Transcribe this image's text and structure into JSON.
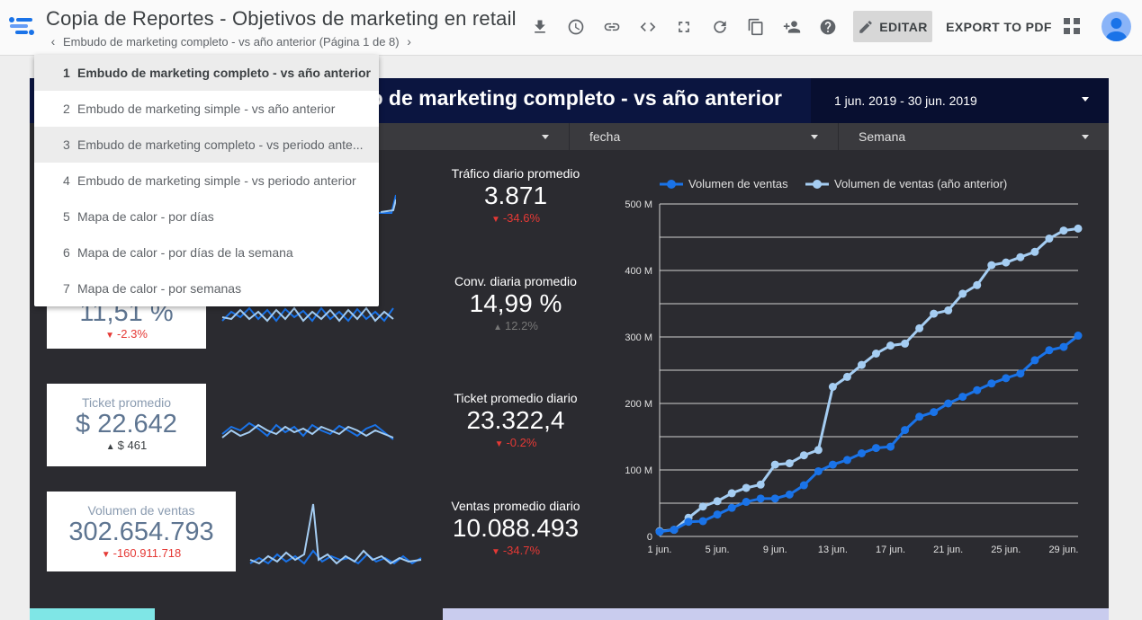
{
  "app": {
    "title": "Copia de Reportes - Objetivos de marketing en retail",
    "page_nav_label": "Embudo de marketing completo - vs año anterior (Página 1 de 8)",
    "edit_label": "EDITAR",
    "export_label": "EXPORT TO PDF",
    "toolbar_icons": [
      "download-icon",
      "history-icon",
      "link-icon",
      "embed-code-icon",
      "fullscreen-icon",
      "refresh-icon",
      "copy-icon",
      "add-person-icon",
      "help-icon",
      "pencil-icon",
      "apps-grid-icon",
      "account-avatar-icon"
    ]
  },
  "report": {
    "title": "o de marketing completo - vs año anterior",
    "date_range": "1 jun. 2019 - 30 jun. 2019",
    "filters": [
      {
        "label": ""
      },
      {
        "label": "fecha"
      },
      {
        "label": "Semana"
      }
    ]
  },
  "dropdown": {
    "items": [
      {
        "num": "1",
        "label": "Embudo de marketing completo - vs año anterior"
      },
      {
        "num": "2",
        "label": "Embudo de marketing simple - vs año anterior"
      },
      {
        "num": "3",
        "label": "Embudo de marketing completo - vs periodo ante..."
      },
      {
        "num": "4",
        "label": "Embudo de marketing simple - vs periodo anterior"
      },
      {
        "num": "5",
        "label": "Mapa de calor - por días"
      },
      {
        "num": "6",
        "label": "Mapa de calor - por días de la semana"
      },
      {
        "num": "7",
        "label": "Mapa de calor - por semanas"
      }
    ]
  },
  "kpis_left": [
    {
      "label": "",
      "value": "11,51 %",
      "delta": "-2.3%",
      "trend": "down"
    },
    {
      "label": "Ticket promedio",
      "value": "$ 22.642",
      "delta": "$ 461",
      "trend": "up"
    },
    {
      "label": "Volumen de ventas",
      "value": "302.654.793",
      "delta": "-160.911.718",
      "trend": "down"
    }
  ],
  "kpis_mid": [
    {
      "label": "Tráfico diario promedio",
      "value": "3.871",
      "delta": "-34.6%",
      "trend": "down"
    },
    {
      "label": "Conv. diaria promedio",
      "value": "14,99 %",
      "delta": "12.2%",
      "trend": "neutral"
    },
    {
      "label": "Ticket promedio diario",
      "value": "23.322,4",
      "delta": "-0.2%",
      "trend": "down"
    },
    {
      "label": "Ventas promedio diario",
      "value": "10.088.493",
      "delta": "-34.7%",
      "trend": "down"
    }
  ],
  "colors": {
    "series_current": "#1a73e8",
    "series_previous": "#a5cdf2",
    "delta_negative": "#e53935",
    "header_bg": "#0b1540",
    "canvas_bg": "#2b2b30"
  },
  "chart_data": {
    "type": "line",
    "title": "",
    "xlabel": "",
    "ylabel": "",
    "legend_position": "top",
    "ylim": [
      0,
      500
    ],
    "y_unit": "M",
    "y_ticks": [
      "0",
      "100 M",
      "200 M",
      "300 M",
      "400 M",
      "500 M"
    ],
    "x_tick_labels": [
      "1 jun.",
      "5 jun.",
      "9 jun.",
      "13 jun.",
      "17 jun.",
      "21 jun.",
      "25 jun.",
      "29 jun."
    ],
    "x": [
      1,
      2,
      3,
      4,
      5,
      6,
      7,
      8,
      9,
      10,
      11,
      12,
      13,
      14,
      15,
      16,
      17,
      18,
      19,
      20,
      21,
      22,
      23,
      24,
      25,
      26,
      27,
      28,
      29,
      30
    ],
    "series": [
      {
        "name": "Volumen de ventas",
        "values": [
          7,
          10,
          22,
          23,
          33,
          43,
          52,
          57,
          57,
          63,
          77,
          98,
          108,
          115,
          125,
          133,
          135,
          160,
          180,
          187,
          200,
          210,
          220,
          230,
          238,
          245,
          265,
          280,
          285,
          302
        ]
      },
      {
        "name": "Volumen de ventas (año anterior)",
        "values": [
          8,
          10,
          28,
          45,
          53,
          65,
          73,
          78,
          108,
          110,
          122,
          130,
          225,
          240,
          258,
          275,
          287,
          290,
          313,
          335,
          340,
          365,
          378,
          408,
          412,
          420,
          428,
          448,
          460,
          463
        ]
      }
    ]
  }
}
